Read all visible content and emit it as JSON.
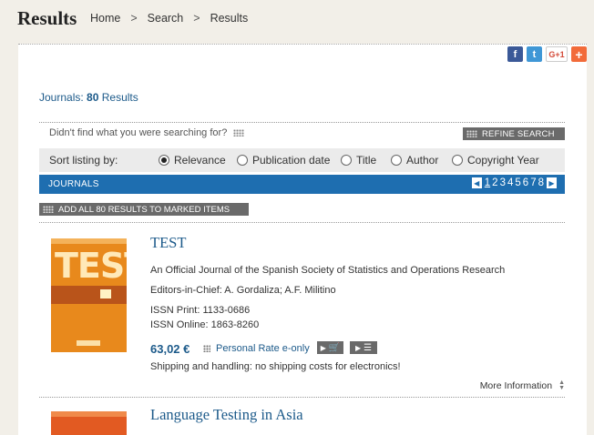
{
  "header": {
    "title": "Results",
    "breadcrumb": [
      "Home",
      "Search",
      "Results"
    ],
    "separator": ">"
  },
  "social": {
    "facebook": "f",
    "twitter": "t",
    "googleplus": "G+1",
    "share": "+"
  },
  "summary": {
    "prefix": "Journals:",
    "count": "80",
    "suffix": "Results"
  },
  "refine": {
    "question": "Didn't find what you were searching for?",
    "button": "REFINE SEARCH"
  },
  "sort": {
    "label": "Sort listing by:",
    "options": [
      "Relevance",
      "Publication date",
      "Title",
      "Author",
      "Copyright Year"
    ],
    "selected": "Relevance"
  },
  "journals_bar": {
    "label": "JOURNALS",
    "pages": [
      "1",
      "2",
      "3",
      "4",
      "5",
      "6",
      "7",
      "8"
    ],
    "current_page": "1"
  },
  "add_all": "ADD ALL 80 RESULTS TO MARKED ITEMS",
  "results": [
    {
      "title": "TEST",
      "cover_word": "TEST",
      "subtitle": "An Official Journal of the Spanish Society of Statistics and Operations Research",
      "editors": "Editors-in-Chief: A. Gordaliza; A.F. Militino",
      "issn_print": "ISSN Print: 1133-0686",
      "issn_online": "ISSN Online: 1863-8260",
      "price": "63,02 €",
      "rate": "Personal Rate e-only",
      "shipping": "Shipping and handling: no shipping costs for electronics!",
      "more": "More Information"
    },
    {
      "title": "Language Testing in Asia"
    }
  ],
  "colors": {
    "accent_blue": "#1e6eb0",
    "link_blue": "#1c5a8a",
    "button_gray": "#6a6a6a",
    "background": "#f2efe8"
  }
}
